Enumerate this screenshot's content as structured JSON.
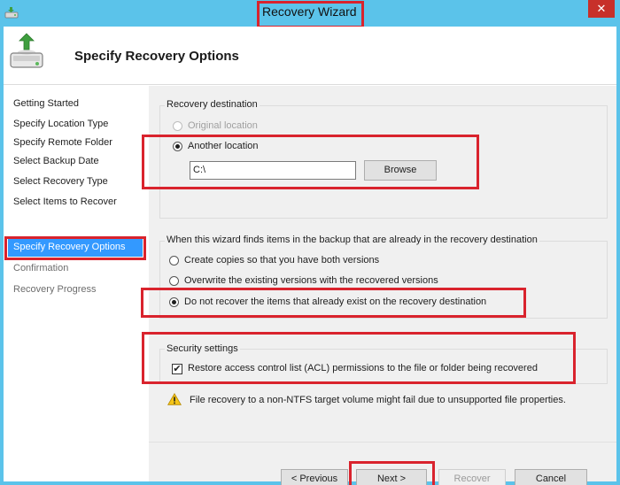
{
  "window": {
    "title": "Recovery Wizard",
    "close_glyph": "✕",
    "app_icon": "backup-disk-icon"
  },
  "header": {
    "title": "Specify Recovery Options",
    "icon": "backup-disk-recovery-icon"
  },
  "nav": {
    "items": [
      {
        "label": "Getting Started",
        "state": "normal"
      },
      {
        "label": "Specify Location Type",
        "state": "normal"
      },
      {
        "label": "Specify Remote Folder",
        "state": "normal"
      },
      {
        "label": "Select Backup Date",
        "state": "normal"
      },
      {
        "label": "Select Recovery Type",
        "state": "normal"
      },
      {
        "label": "Select Items to Recover",
        "state": "normal"
      },
      {
        "label": "Specify Recovery Options",
        "state": "active"
      },
      {
        "label": "Confirmation",
        "state": "disabled"
      },
      {
        "label": "Recovery Progress",
        "state": "disabled"
      }
    ]
  },
  "destination": {
    "group_label": "Recovery destination",
    "original_label": "Original location",
    "another_label": "Another location",
    "path_value": "C:\\",
    "browse_label": "Browse"
  },
  "conflict": {
    "group_label": "When this wizard finds items in the backup that are already in the recovery destination",
    "options": [
      "Create copies so that you have both versions",
      "Overwrite the existing versions with the recovered versions",
      "Do not recover the items that already exist on the recovery destination"
    ],
    "selected_index": 2
  },
  "security": {
    "group_label": "Security settings",
    "acl_label": "Restore access control list (ACL) permissions to the file or folder being recovered",
    "acl_checked": true,
    "check_glyph": "✔"
  },
  "warning": {
    "text": "File recovery to a non-NTFS target volume might fail due to unsupported file properties.",
    "icon": "warning-icon"
  },
  "buttons": {
    "previous": "< Previous",
    "next": "Next >",
    "recover": "Recover",
    "cancel": "Cancel"
  },
  "colors": {
    "title_bar": "#5bc3ea",
    "highlight_box": "#d9232d",
    "nav_active": "#3399ff"
  }
}
